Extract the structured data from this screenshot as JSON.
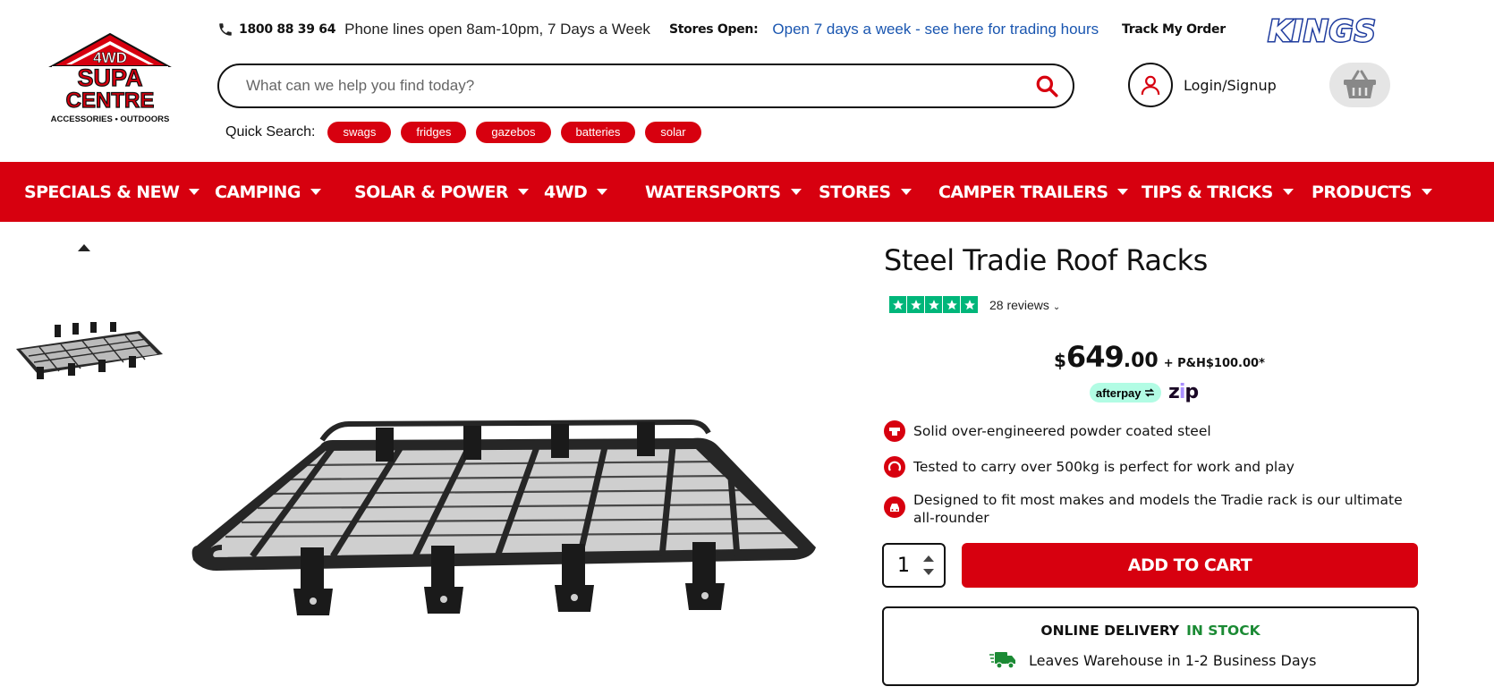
{
  "brand": {
    "logo_top": "4WD",
    "logo_mid1": "SUPA",
    "logo_mid2": "CENTRE",
    "logo_tag": "ACCESSORIES • OUTDOORS",
    "partner_logo": "KINGS"
  },
  "topbar": {
    "phone": "1800 88 39 64",
    "phone_hours": "Phone lines open 8am-10pm, 7 Days a Week",
    "stores_label": "Stores Open:",
    "stores_link": "Open 7 days a week - see here for trading hours",
    "track_label": "Track My Order"
  },
  "search": {
    "placeholder": "What can we help you find today?",
    "value": ""
  },
  "quick_search": {
    "label": "Quick Search:",
    "tags": [
      "swags",
      "fridges",
      "gazebos",
      "batteries",
      "solar"
    ]
  },
  "account": {
    "label": "Login/Signup"
  },
  "nav": {
    "items": [
      "SPECIALS & NEW",
      "CAMPING",
      "SOLAR & POWER",
      "4WD",
      "WATERSPORTS",
      "STORES",
      "CAMPER TRAILERS",
      "TIPS & TRICKS",
      "PRODUCTS"
    ]
  },
  "product": {
    "title": "Steel Tradie Roof Racks",
    "rating_stars": 5,
    "reviews": "28 reviews",
    "price_currency": "$",
    "price_dollars": "649",
    "price_cents": ".00",
    "postage": "+ P&H$100.00*",
    "afterpay_label": "afterpay",
    "zip_label": "zip",
    "features": [
      "Solid over-engineered powder coated steel",
      "Tested to carry over 500kg is perfect for work and play",
      "Designed to fit most makes and models the Tradie rack is our ultimate all-rounder"
    ],
    "quantity": "1",
    "add_to_cart": "ADD TO CART",
    "delivery_label": "ONLINE DELIVERY",
    "stock_status": "IN STOCK",
    "delivery_time": "Leaves Warehouse in 1-2 Business Days"
  },
  "colors": {
    "brand_red": "#d7000f",
    "link_blue": "#1a56b0",
    "trustpilot_green": "#00b67a",
    "stock_green": "#1b8a34"
  }
}
